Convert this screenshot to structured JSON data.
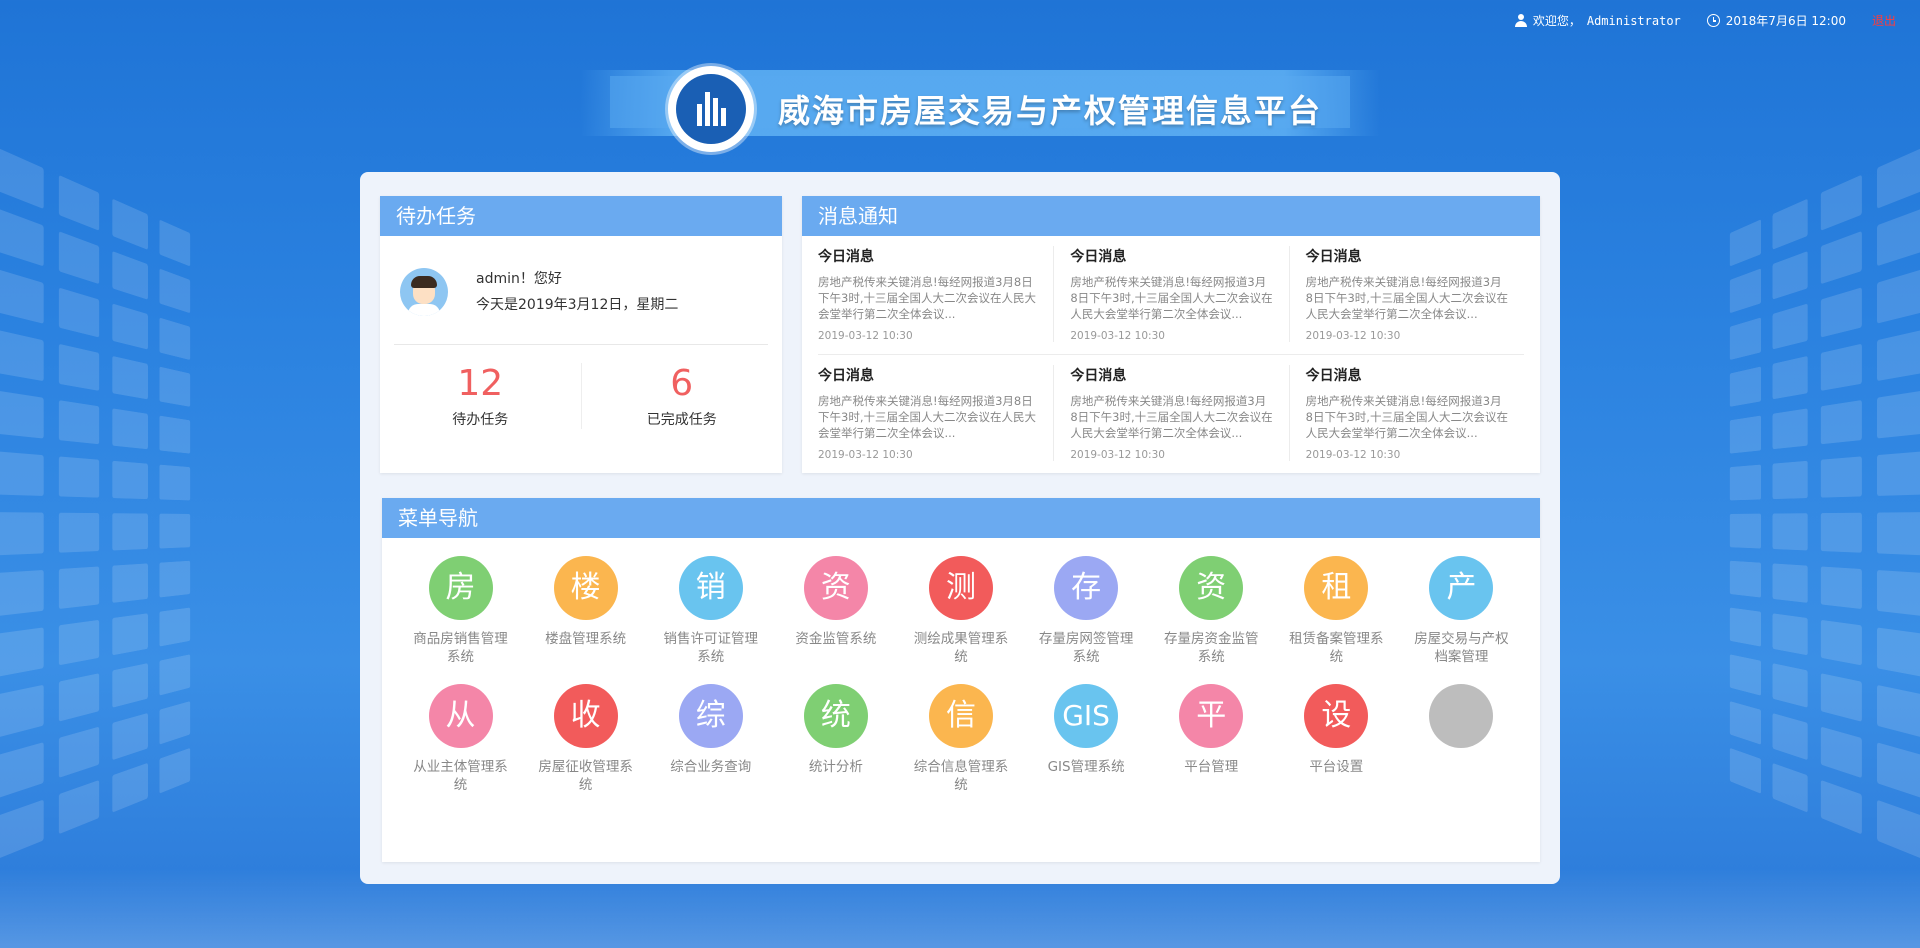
{
  "header": {
    "welcome": "欢迎您，",
    "username": "Administrator",
    "datetime": "2018年7月6日 12:00",
    "logout": "退出"
  },
  "site": {
    "title": "威海市房屋交易与产权管理信息平台"
  },
  "todo": {
    "heading": "待办任务",
    "greeting": "admin！您好",
    "date_line": "今天是2019年3月12日，星期二",
    "pending_count": "12",
    "pending_label": "待办任务",
    "done_count": "6",
    "done_label": "已完成任务"
  },
  "messages": {
    "heading": "消息通知",
    "items": [
      {
        "title": "今日消息",
        "body": "房地产税传来关键消息!每经网报道3月8日下午3时,十三届全国人大二次会议在人民大会堂举行第二次全体会议...",
        "date": "2019-03-12 10:30"
      },
      {
        "title": "今日消息",
        "body": "房地产税传来关键消息!每经网报道3月8日下午3时,十三届全国人大二次会议在人民大会堂举行第二次全体会议...",
        "date": "2019-03-12 10:30"
      },
      {
        "title": "今日消息",
        "body": "房地产税传来关键消息!每经网报道3月8日下午3时,十三届全国人大二次会议在人民大会堂举行第二次全体会议...",
        "date": "2019-03-12 10:30"
      },
      {
        "title": "今日消息",
        "body": "房地产税传来关键消息!每经网报道3月8日下午3时,十三届全国人大二次会议在人民大会堂举行第二次全体会议...",
        "date": "2019-03-12 10:30"
      },
      {
        "title": "今日消息",
        "body": "房地产税传来关键消息!每经网报道3月8日下午3时,十三届全国人大二次会议在人民大会堂举行第二次全体会议...",
        "date": "2019-03-12 10:30"
      },
      {
        "title": "今日消息",
        "body": "房地产税传来关键消息!每经网报道3月8日下午3时,十三届全国人大二次会议在人民大会堂举行第二次全体会议...",
        "date": "2019-03-12 10:30"
      }
    ]
  },
  "menu": {
    "heading": "菜单导航",
    "items": [
      {
        "glyph": "房",
        "label": "商品房销售管理系统",
        "color": "#7fcf73"
      },
      {
        "glyph": "楼",
        "label": "楼盘管理系统",
        "color": "#fbb64f"
      },
      {
        "glyph": "销",
        "label": "销售许可证管理系统",
        "color": "#69c4ef"
      },
      {
        "glyph": "资",
        "label": "资金监管系统",
        "color": "#f486a8"
      },
      {
        "glyph": "测",
        "label": "测绘成果管理系统",
        "color": "#f25b5b"
      },
      {
        "glyph": "存",
        "label": "存量房网签管理系统",
        "color": "#9ba8f3"
      },
      {
        "glyph": "资",
        "label": "存量房资金监管系统",
        "color": "#7fcf73"
      },
      {
        "glyph": "租",
        "label": "租赁备案管理系统",
        "color": "#fbb64f"
      },
      {
        "glyph": "产",
        "label": "房屋交易与产权档案管理",
        "color": "#69c4ef"
      },
      {
        "glyph": "从",
        "label": "从业主体管理系统",
        "color": "#f486a8"
      },
      {
        "glyph": "收",
        "label": "房屋征收管理系统",
        "color": "#f25b5b"
      },
      {
        "glyph": "综",
        "label": "综合业务查询",
        "color": "#9ba8f3"
      },
      {
        "glyph": "统",
        "label": "统计分析",
        "color": "#7fcf73"
      },
      {
        "glyph": "信",
        "label": "综合信息管理系统",
        "color": "#fbb64f"
      },
      {
        "glyph": "GIS",
        "label": "GIS管理系统",
        "color": "#69c4ef"
      },
      {
        "glyph": "平",
        "label": "平台管理",
        "color": "#f486a8"
      },
      {
        "glyph": "设",
        "label": "平台设置",
        "color": "#f25b5b"
      },
      {
        "glyph": "",
        "label": "",
        "color": "#bdbdbd"
      }
    ]
  }
}
